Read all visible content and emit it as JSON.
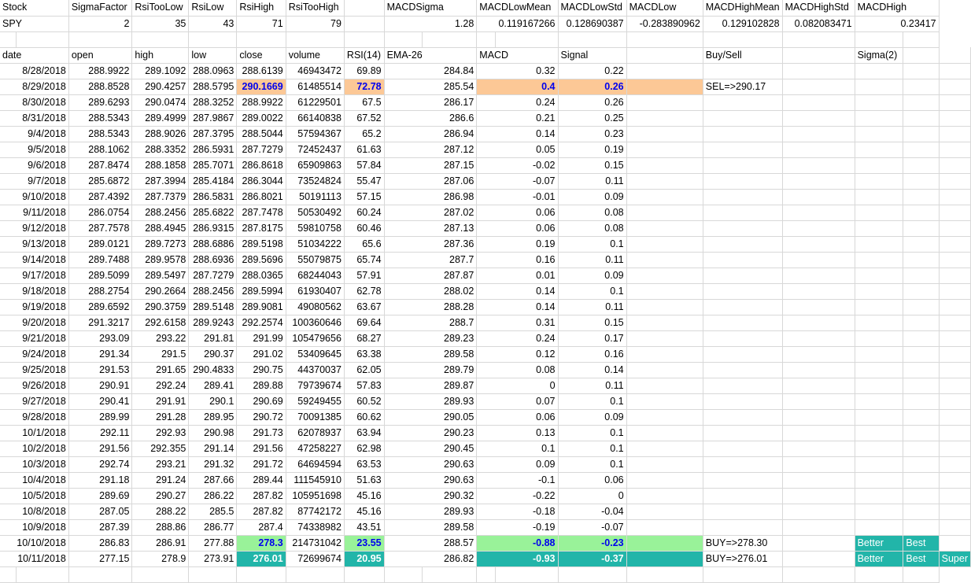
{
  "params": {
    "headers": [
      "Stock",
      "SigmaFactor",
      "RsiTooLow",
      "RsiLow",
      "RsiHigh",
      "RsiTooHigh",
      "",
      "MACDSigma",
      "MACDLowMean",
      "MACDLowStd",
      "MACDLow",
      "MACDHighMean",
      "MACDHighStd",
      "MACDHigh"
    ],
    "values": [
      "SPY",
      "2",
      "35",
      "43",
      "71",
      "79",
      "",
      "1.28",
      "0.119167266",
      "0.128690387",
      "-0.283890962",
      "0.129102828",
      "0.082083471",
      "0.23417"
    ]
  },
  "table": {
    "headers": [
      "date",
      "open",
      "high",
      "low",
      "close",
      "volume",
      "RSI(14)",
      "EMA-26",
      "MACD",
      "",
      "Signal",
      "",
      "Buy/Sell",
      "",
      "Sigma(2)",
      "",
      ""
    ],
    "rows": [
      [
        "8/28/2018",
        "288.9922",
        "289.1092",
        "288.0963",
        "288.6139",
        "46943472",
        "69.89",
        "284.84",
        "0.32",
        "",
        "0.22",
        "",
        "",
        "",
        "",
        "",
        ""
      ],
      [
        "8/29/2018",
        "288.8528",
        "290.4257",
        "288.5795",
        "290.1669",
        "61485514",
        "72.78",
        "285.54",
        "0.4",
        "",
        "0.26",
        "",
        "SEL=>290.17",
        "",
        "",
        "",
        ""
      ],
      [
        "8/30/2018",
        "289.6293",
        "290.0474",
        "288.3252",
        "288.9922",
        "61229501",
        "67.5",
        "286.17",
        "0.24",
        "",
        "0.26",
        "",
        "",
        "",
        "",
        "",
        ""
      ],
      [
        "8/31/2018",
        "288.5343",
        "289.4999",
        "287.9867",
        "289.0022",
        "66140838",
        "67.52",
        "286.6",
        "0.21",
        "",
        "0.25",
        "",
        "",
        "",
        "",
        "",
        ""
      ],
      [
        "9/4/2018",
        "288.5343",
        "288.9026",
        "287.3795",
        "288.5044",
        "57594367",
        "65.2",
        "286.94",
        "0.14",
        "",
        "0.23",
        "",
        "",
        "",
        "",
        "",
        ""
      ],
      [
        "9/5/2018",
        "288.1062",
        "288.3352",
        "286.5931",
        "287.7279",
        "72452437",
        "61.63",
        "287.12",
        "0.05",
        "",
        "0.19",
        "",
        "",
        "",
        "",
        "",
        ""
      ],
      [
        "9/6/2018",
        "287.8474",
        "288.1858",
        "285.7071",
        "286.8618",
        "65909863",
        "57.84",
        "287.15",
        "-0.02",
        "",
        "0.15",
        "",
        "",
        "",
        "",
        "",
        ""
      ],
      [
        "9/7/2018",
        "285.6872",
        "287.3994",
        "285.4184",
        "286.3044",
        "73524824",
        "55.47",
        "287.06",
        "-0.07",
        "",
        "0.11",
        "",
        "",
        "",
        "",
        "",
        ""
      ],
      [
        "9/10/2018",
        "287.4392",
        "287.7379",
        "286.5831",
        "286.8021",
        "50191113",
        "57.15",
        "286.98",
        "-0.01",
        "",
        "0.09",
        "",
        "",
        "",
        "",
        "",
        ""
      ],
      [
        "9/11/2018",
        "286.0754",
        "288.2456",
        "285.6822",
        "287.7478",
        "50530492",
        "60.24",
        "287.02",
        "0.06",
        "",
        "0.08",
        "",
        "",
        "",
        "",
        "",
        ""
      ],
      [
        "9/12/2018",
        "287.7578",
        "288.4945",
        "286.9315",
        "287.8175",
        "59810758",
        "60.46",
        "287.13",
        "0.06",
        "",
        "0.08",
        "",
        "",
        "",
        "",
        "",
        ""
      ],
      [
        "9/13/2018",
        "289.0121",
        "289.7273",
        "288.6886",
        "289.5198",
        "51034222",
        "65.6",
        "287.36",
        "0.19",
        "",
        "0.1",
        "",
        "",
        "",
        "",
        "",
        ""
      ],
      [
        "9/14/2018",
        "289.7488",
        "289.9578",
        "288.6936",
        "289.5696",
        "55079875",
        "65.74",
        "287.7",
        "0.16",
        "",
        "0.11",
        "",
        "",
        "",
        "",
        "",
        ""
      ],
      [
        "9/17/2018",
        "289.5099",
        "289.5497",
        "287.7279",
        "288.0365",
        "68244043",
        "57.91",
        "287.87",
        "0.01",
        "",
        "0.09",
        "",
        "",
        "",
        "",
        "",
        ""
      ],
      [
        "9/18/2018",
        "288.2754",
        "290.2664",
        "288.2456",
        "289.5994",
        "61930407",
        "62.78",
        "288.02",
        "0.14",
        "",
        "0.1",
        "",
        "",
        "",
        "",
        "",
        ""
      ],
      [
        "9/19/2018",
        "289.6592",
        "290.3759",
        "289.5148",
        "289.9081",
        "49080562",
        "63.67",
        "288.28",
        "0.14",
        "",
        "0.11",
        "",
        "",
        "",
        "",
        "",
        ""
      ],
      [
        "9/20/2018",
        "291.3217",
        "292.6158",
        "289.9243",
        "292.2574",
        "100360646",
        "69.64",
        "288.7",
        "0.31",
        "",
        "0.15",
        "",
        "",
        "",
        "",
        "",
        ""
      ],
      [
        "9/21/2018",
        "293.09",
        "293.22",
        "291.81",
        "291.99",
        "105479656",
        "68.27",
        "289.23",
        "0.24",
        "",
        "0.17",
        "",
        "",
        "",
        "",
        "",
        ""
      ],
      [
        "9/24/2018",
        "291.34",
        "291.5",
        "290.37",
        "291.02",
        "53409645",
        "63.38",
        "289.58",
        "0.12",
        "",
        "0.16",
        "",
        "",
        "",
        "",
        "",
        ""
      ],
      [
        "9/25/2018",
        "291.53",
        "291.65",
        "290.4833",
        "290.75",
        "44370037",
        "62.05",
        "289.79",
        "0.08",
        "",
        "0.14",
        "",
        "",
        "",
        "",
        "",
        ""
      ],
      [
        "9/26/2018",
        "290.91",
        "292.24",
        "289.41",
        "289.88",
        "79739674",
        "57.83",
        "289.87",
        "0",
        "",
        "0.11",
        "",
        "",
        "",
        "",
        "",
        ""
      ],
      [
        "9/27/2018",
        "290.41",
        "291.91",
        "290.1",
        "290.69",
        "59249455",
        "60.52",
        "289.93",
        "0.07",
        "",
        "0.1",
        "",
        "",
        "",
        "",
        "",
        ""
      ],
      [
        "9/28/2018",
        "289.99",
        "291.28",
        "289.95",
        "290.72",
        "70091385",
        "60.62",
        "290.05",
        "0.06",
        "",
        "0.09",
        "",
        "",
        "",
        "",
        "",
        ""
      ],
      [
        "10/1/2018",
        "292.11",
        "292.93",
        "290.98",
        "291.73",
        "62078937",
        "63.94",
        "290.23",
        "0.13",
        "",
        "0.1",
        "",
        "",
        "",
        "",
        "",
        ""
      ],
      [
        "10/2/2018",
        "291.56",
        "292.355",
        "291.14",
        "291.56",
        "47258227",
        "62.98",
        "290.45",
        "0.1",
        "",
        "0.1",
        "",
        "",
        "",
        "",
        "",
        ""
      ],
      [
        "10/3/2018",
        "292.74",
        "293.21",
        "291.32",
        "291.72",
        "64694594",
        "63.53",
        "290.63",
        "0.09",
        "",
        "0.1",
        "",
        "",
        "",
        "",
        "",
        ""
      ],
      [
        "10/4/2018",
        "291.18",
        "291.24",
        "287.66",
        "289.44",
        "111545910",
        "51.63",
        "290.63",
        "-0.1",
        "",
        "0.06",
        "",
        "",
        "",
        "",
        "",
        ""
      ],
      [
        "10/5/2018",
        "289.69",
        "290.27",
        "286.22",
        "287.82",
        "105951698",
        "45.16",
        "290.32",
        "-0.22",
        "",
        "0",
        "",
        "",
        "",
        "",
        "",
        ""
      ],
      [
        "10/8/2018",
        "287.05",
        "288.22",
        "285.5",
        "287.82",
        "87742172",
        "45.16",
        "289.93",
        "-0.18",
        "",
        "-0.04",
        "",
        "",
        "",
        "",
        "",
        ""
      ],
      [
        "10/9/2018",
        "287.39",
        "288.86",
        "286.77",
        "287.4",
        "74338982",
        "43.51",
        "289.58",
        "-0.19",
        "",
        "-0.07",
        "",
        "",
        "",
        "",
        "",
        ""
      ],
      [
        "10/10/2018",
        "286.83",
        "286.91",
        "277.88",
        "278.3",
        "214731042",
        "23.55",
        "288.57",
        "-0.88",
        "",
        "-0.23",
        "",
        "BUY=>278.30",
        "",
        "Better",
        "Best",
        ""
      ],
      [
        "10/11/2018",
        "277.15",
        "278.9",
        "273.91",
        "276.01",
        "72699674",
        "20.95",
        "286.82",
        "-0.93",
        "",
        "-0.37",
        "",
        "BUY=>276.01",
        "",
        "Better",
        "Best",
        "Super"
      ]
    ]
  }
}
